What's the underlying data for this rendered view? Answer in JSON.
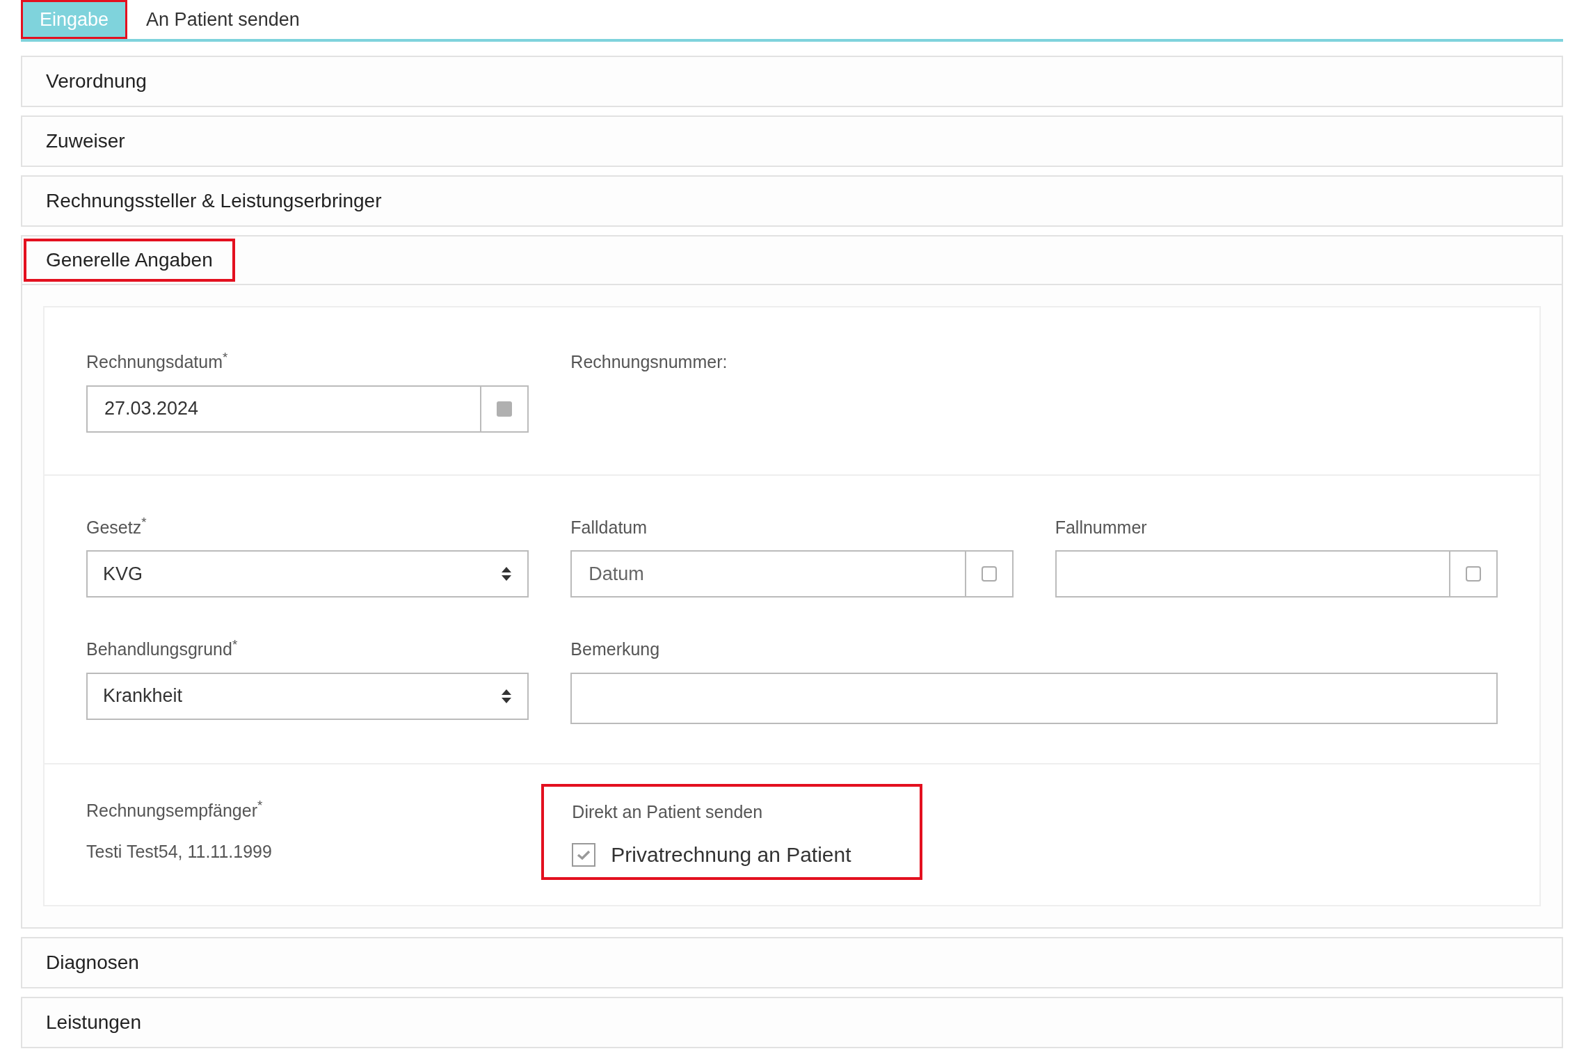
{
  "tabs": [
    {
      "label": "Eingabe",
      "selected": true,
      "highlighted": true
    },
    {
      "label": "An Patient senden",
      "selected": false,
      "highlighted": false
    }
  ],
  "sections": [
    {
      "title": "Verordnung",
      "highlighted": false
    },
    {
      "title": "Zuweiser",
      "highlighted": false
    },
    {
      "title": "Rechnungssteller & Leistungserbringer",
      "highlighted": false
    },
    {
      "title": "Generelle Angaben",
      "highlighted": true,
      "has_form": true
    },
    {
      "title": "Diagnosen",
      "highlighted": false
    },
    {
      "title": "Leistungen",
      "highlighted": false
    }
  ],
  "form": {
    "invoice_date": {
      "label": "Rechnungsdatum$^{*}$",
      "value": "27.03.2024"
    },
    "invoice_number": {
      "label": "Rechnungsnummer:"
    },
    "law": {
      "label": "Gesetz$^{*}$",
      "value": "KVG"
    },
    "case_date": {
      "label": "Falldatum",
      "placeholder": "Datum"
    },
    "case_number": {
      "label": "Fallnummer"
    },
    "reason": {
      "label": "Behandlungsgrund$^{*}$",
      "value": "Krankheit"
    },
    "remark": {
      "label": "Bemerkung"
    },
    "recipient": {
      "label": "Rechnungsempfänger$^{*}$",
      "value": "Testi Test54, 11.11.1999"
    },
    "direct": {
      "label": "Direkt an Patient senden",
      "highlighted": true,
      "checkbox": {
        "label": "Privatrechnung an Patient",
        "checked": true
      }
    }
  }
}
